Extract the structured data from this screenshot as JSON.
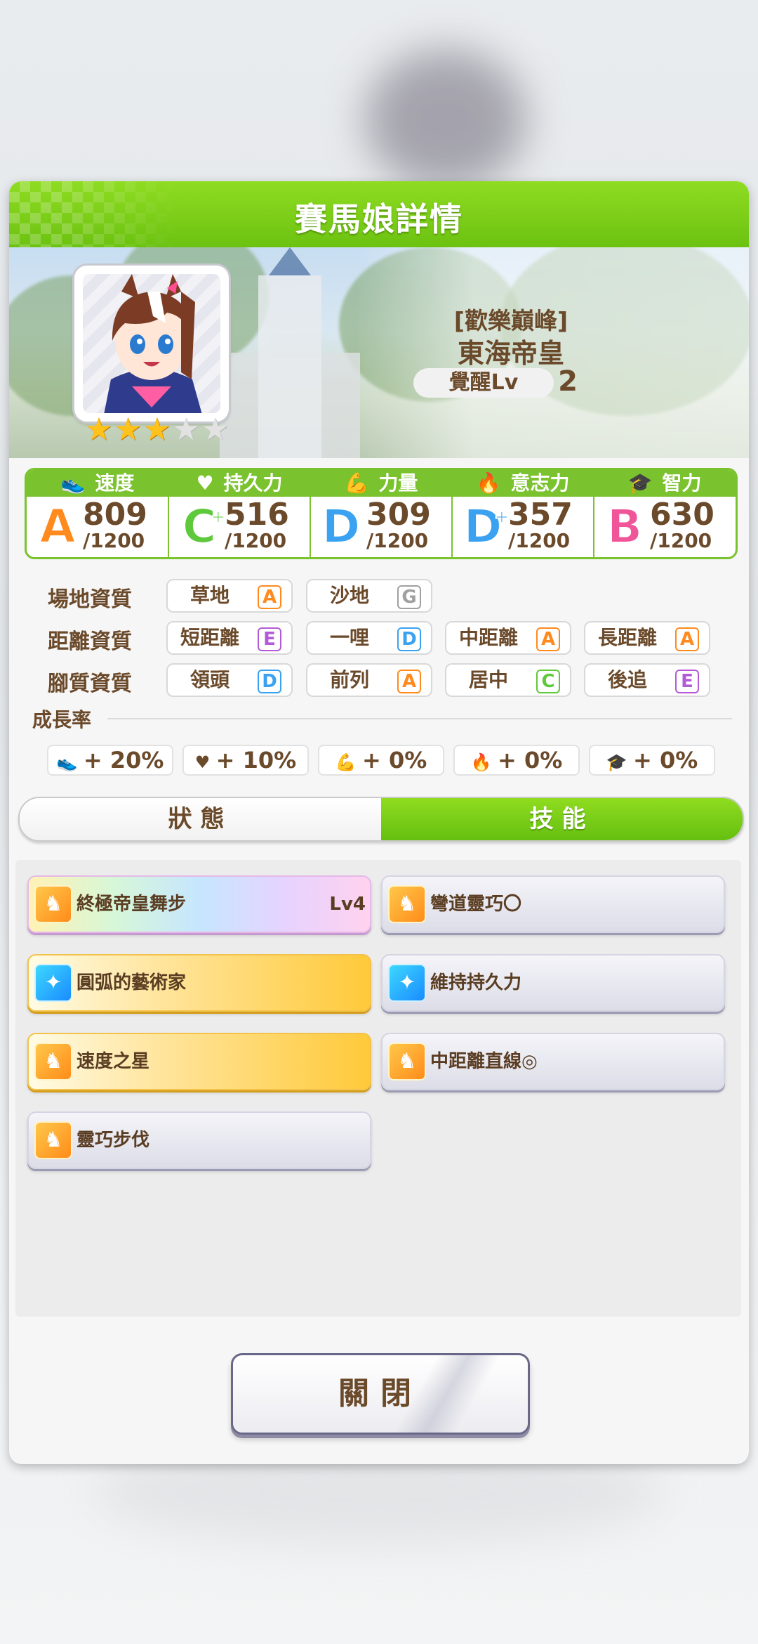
{
  "dialog": {
    "title": "賽馬娘詳情"
  },
  "character": {
    "epithet": "[歡樂巔峰]",
    "name": "東海帝皇",
    "awakening_label": "覺醒Lv",
    "awakening_level": "2",
    "stars_filled": 3,
    "stars_total": 5
  },
  "stats": [
    {
      "label": "速度",
      "icon": "shoe-icon",
      "glyph": "👟",
      "grade": "A",
      "grade_color": "#ff8a1e",
      "value": "809",
      "max": "/1200"
    },
    {
      "label": "持久力",
      "icon": "heart-icon",
      "glyph": "♥",
      "grade": "C",
      "grade_color": "#5ec93b",
      "plus": true,
      "value": "516",
      "max": "/1200"
    },
    {
      "label": "力量",
      "icon": "arm-icon",
      "glyph": "💪",
      "grade": "D",
      "grade_color": "#3aa2f0",
      "value": "309",
      "max": "/1200"
    },
    {
      "label": "意志力",
      "icon": "flame-icon",
      "glyph": "🔥",
      "grade": "D",
      "grade_color": "#3aa2f0",
      "plus": true,
      "value": "357",
      "max": "/1200"
    },
    {
      "label": "智力",
      "icon": "graduation-cap-icon",
      "glyph": "🎓",
      "grade": "B",
      "grade_color": "#f0559a",
      "value": "630",
      "max": "/1200"
    }
  ],
  "aptitudes": {
    "track": {
      "label": "場地資質",
      "items": [
        {
          "name": "草地",
          "grade": "A"
        },
        {
          "name": "沙地",
          "grade": "G"
        }
      ]
    },
    "distance": {
      "label": "距離資質",
      "items": [
        {
          "name": "短距離",
          "grade": "E"
        },
        {
          "name": "一哩",
          "grade": "D"
        },
        {
          "name": "中距離",
          "grade": "A"
        },
        {
          "name": "長距離",
          "grade": "A"
        }
      ]
    },
    "strategy": {
      "label": "腳質資質",
      "items": [
        {
          "name": "領頭",
          "grade": "D"
        },
        {
          "name": "前列",
          "grade": "A"
        },
        {
          "name": "居中",
          "grade": "C"
        },
        {
          "name": "後追",
          "grade": "E"
        }
      ]
    }
  },
  "grade_colors": {
    "A": "#ff8a1e",
    "B": "#f0559a",
    "C": "#5ec93b",
    "D": "#3aa2f0",
    "E": "#b45ad8",
    "G": "#a0a0a0"
  },
  "growth": {
    "label": "成長率",
    "items": [
      {
        "icon": "shoe-icon",
        "glyph": "👟",
        "value": "+ 20%"
      },
      {
        "icon": "heart-icon",
        "glyph": "♥",
        "value": "+ 10%"
      },
      {
        "icon": "arm-icon",
        "glyph": "💪",
        "value": "+ 0%"
      },
      {
        "icon": "flame-icon",
        "glyph": "🔥",
        "value": "+ 0%"
      },
      {
        "icon": "graduation-cap-icon",
        "glyph": "🎓",
        "value": "+ 0%"
      }
    ]
  },
  "tabs": {
    "status": "狀態",
    "skills": "技能",
    "active": "skills"
  },
  "skills": [
    {
      "name": "終極帝皇舞步",
      "level": "Lv4",
      "style": "rainbow",
      "icon": "orange"
    },
    {
      "name": "彎道靈巧〇",
      "level": "",
      "style": "plain",
      "icon": "orange"
    },
    {
      "name": "圓弧的藝術家",
      "level": "",
      "style": "gold",
      "icon": "blue"
    },
    {
      "name": "維持持久力",
      "level": "",
      "style": "plain",
      "icon": "blue"
    },
    {
      "name": "速度之星",
      "level": "",
      "style": "gold",
      "icon": "orange"
    },
    {
      "name": "中距離直線◎",
      "level": "",
      "style": "plain",
      "icon": "orange"
    },
    {
      "name": "靈巧步伐",
      "level": "",
      "style": "plain",
      "icon": "orange"
    }
  ],
  "close_button": {
    "label": "關閉"
  }
}
